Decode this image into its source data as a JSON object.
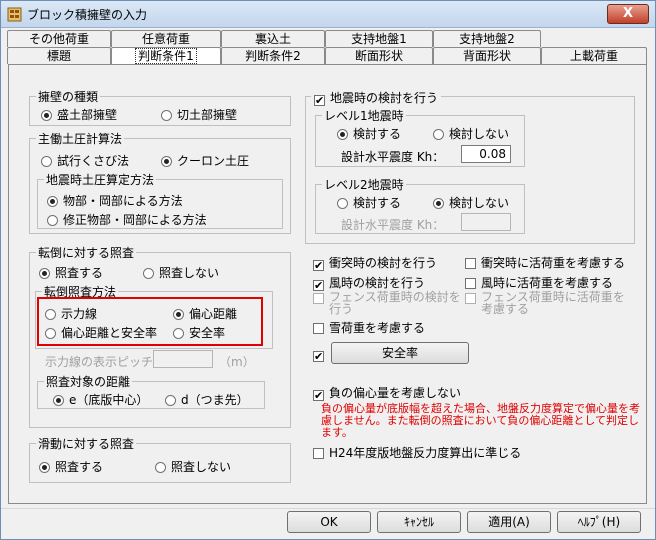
{
  "window": {
    "title": "ブロック積擁壁の入力",
    "close_label": "X"
  },
  "tabs_row1": [
    "その他荷重",
    "任意荷重",
    "裏込土",
    "支持地盤1",
    "支持地盤2"
  ],
  "tabs_row2": [
    "標題",
    "判断条件1",
    "判断条件2",
    "断面形状",
    "背面形状",
    "上載荷重"
  ],
  "wall_type": {
    "title": "擁壁の種類",
    "options": [
      "盛土部擁壁",
      "切土部擁壁"
    ],
    "selected": 0
  },
  "main_pressure": {
    "title": "主働土圧計算法",
    "options": [
      "試行くさび法",
      "クーロン土圧"
    ],
    "selected": 1
  },
  "seismic_pressure": {
    "title": "地震時土圧算定方法",
    "options": [
      "物部・岡部による方法",
      "修正物部・岡部による方法"
    ],
    "selected": 0
  },
  "overturn": {
    "title": "転倒に対する照査",
    "options": [
      "照査する",
      "照査しない"
    ],
    "selected": 0
  },
  "overturn_method": {
    "title": "転倒照査方法",
    "options": [
      "示力線",
      "偏心距離",
      "偏心距離と安全率",
      "安全率"
    ],
    "selected": 1
  },
  "pitch": {
    "label": "示力線の表示ピッチ:",
    "unit": "（m）",
    "value": ""
  },
  "distance": {
    "title": "照査対象の距離",
    "options": [
      "e（底版中心）",
      "d（つま先）"
    ],
    "selected": 0
  },
  "sliding": {
    "title": "滑動に対する照査",
    "options": [
      "照査する",
      "照査しない"
    ],
    "selected": 0
  },
  "seismic_check": {
    "label": "地震時の検討を行う",
    "checked": true
  },
  "level1": {
    "title": "レベル1地震時",
    "options": [
      "検討する",
      "検討しない"
    ],
    "selected": 0,
    "kh_label": "設計水平震度 Kh：",
    "kh_value": "0.08"
  },
  "level2": {
    "title": "レベル2地震時",
    "options": [
      "検討する",
      "検討しない"
    ],
    "selected": 1,
    "kh_label": "設計水平震度 Kh：",
    "kh_value": ""
  },
  "checks": [
    {
      "label": "衝突時の検討を行う",
      "checked": true,
      "disabled": false
    },
    {
      "label": "衝突時に活荷重を考慮する",
      "checked": false,
      "disabled": false
    },
    {
      "label": "風時の検討を行う",
      "checked": true,
      "disabled": false
    },
    {
      "label": "風時に活荷重を考慮する",
      "checked": false,
      "disabled": false
    },
    {
      "label": "フェンス荷重時の検討を行う",
      "checked": false,
      "disabled": true
    },
    {
      "label": "フェンス荷重時に活荷重を考慮する",
      "checked": false,
      "disabled": true
    },
    {
      "label": "雪荷重を考慮する",
      "checked": false,
      "disabled": false
    }
  ],
  "safety": {
    "checked": true,
    "button_label": "安全率"
  },
  "neg_ecc": {
    "label": "負の偏心量を考慮しない",
    "checked": true
  },
  "warning_text": "負の偏心量が底版幅を超えた場合、地盤反力度算定で偏心量を考慮しません。また転倒の照査において負の偏心距離として判定します。",
  "h24": {
    "label": "H24年度版地盤反力度算出に準じる",
    "checked": false
  },
  "buttons": {
    "ok": "OK",
    "cancel": "ｷｬﾝｾﾙ",
    "apply": "適用(A)",
    "help": "ﾍﾙﾌﾟ(H)"
  }
}
